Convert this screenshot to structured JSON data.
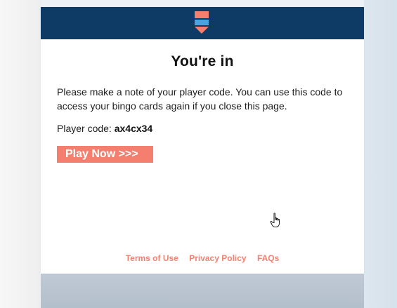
{
  "page": {
    "title": "You're in",
    "message": "Please make a note of your player code. You can use this code to access your bingo cards again if you close this page.",
    "player_code_label": "Player code:",
    "player_code": "ax4cx34",
    "play_button_label": "Play Now >>>"
  },
  "footer": {
    "links": [
      "Terms of Use",
      "Privacy Policy",
      "FAQs"
    ]
  },
  "colors": {
    "header_bg": "#0d3b66",
    "accent": "#f47f6e",
    "logo_blue": "#4aa3df"
  },
  "icons": {
    "logo": "bookmark-flag-icon",
    "cursor": "hand-pointer-icon"
  }
}
